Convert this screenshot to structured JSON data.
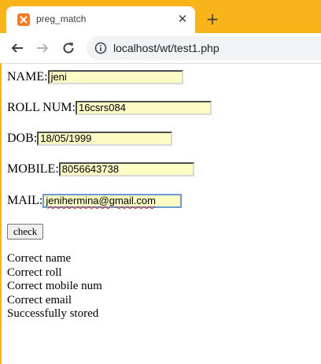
{
  "browser": {
    "tab_title": "preg_match",
    "tab_close_glyph": "✕",
    "new_tab_glyph": "+",
    "url": "localhost/wt/test1.php",
    "accent_color": "#f9b41a"
  },
  "form": {
    "fields": [
      {
        "label": "NAME:",
        "value": "jeni"
      },
      {
        "label": "ROLL NUM:",
        "value": "16csrs084"
      },
      {
        "label": "DOB:",
        "value": "18/05/1999"
      },
      {
        "label": "MOBILE:",
        "value": "8056643738"
      },
      {
        "label": "MAIL:",
        "value": "jenihermina@gmail.com"
      }
    ],
    "submit_label": "check",
    "field_bg_color": "#fcfcc4"
  },
  "messages": [
    "Correct name",
    "Correct roll",
    "Correct mobile num",
    "Correct email",
    "Successfully stored"
  ]
}
